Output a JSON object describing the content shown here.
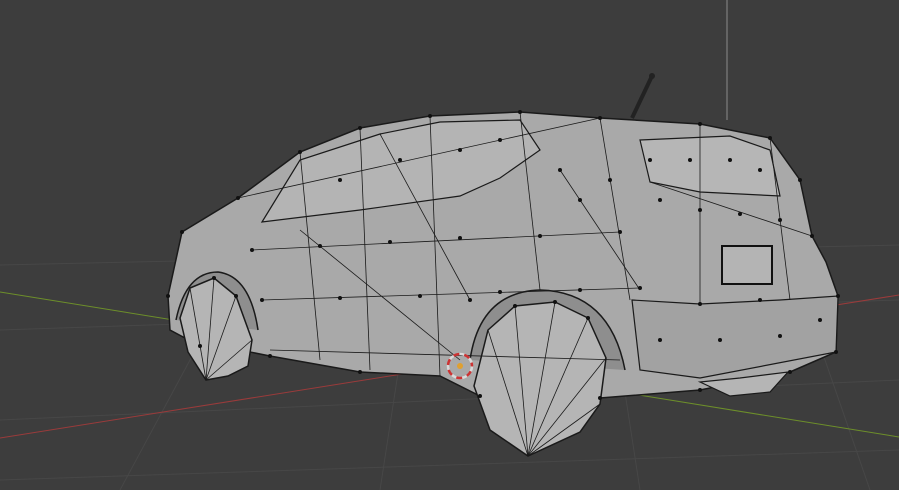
{
  "viewport": {
    "background": "#3d3d3d",
    "grid_color": "#474747",
    "x_axis_color": "#9a3b3b",
    "y_axis_color": "#6d8f2a",
    "z_axis_color": "#8c8c8c"
  },
  "object": {
    "type": "car-mesh",
    "shading": "solid",
    "surface_color": "#a9a9a9",
    "wire_color": "#1a1a1a",
    "mode": "edit-mode-vertices"
  },
  "cursor": {
    "icon": "3d-cursor-icon",
    "ring_colors": [
      "#d9d9d9",
      "#c33"
    ],
    "center_color": "#e0a030"
  }
}
